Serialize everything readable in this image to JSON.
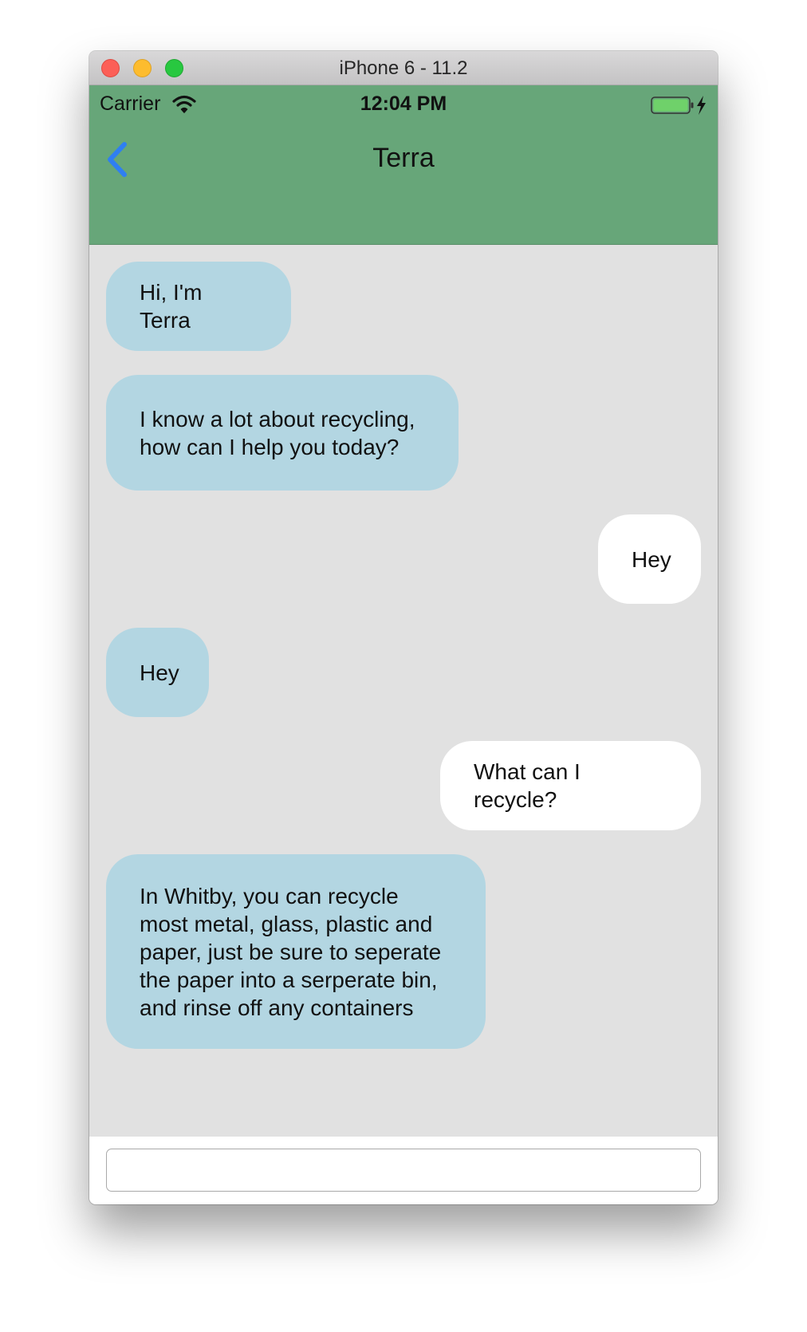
{
  "window": {
    "title": "iPhone 6 - 11.2"
  },
  "status_bar": {
    "carrier": "Carrier",
    "time": "12:04 PM",
    "wifi_icon": "wifi-icon",
    "battery_icon": "battery-charging-icon"
  },
  "nav": {
    "title": "Terra",
    "back_icon": "chevron-left-icon"
  },
  "colors": {
    "header": "#67a679",
    "bot_bubble": "#b3d6e2",
    "user_bubble": "#ffffff",
    "chat_background": "#e1e1e1",
    "back_icon": "#2f7ff1"
  },
  "messages": [
    {
      "sender": "bot",
      "text": "Hi, I'm Terra"
    },
    {
      "sender": "bot",
      "text": "I know a lot about recycling,\nhow can I help you today?"
    },
    {
      "sender": "user",
      "text": "Hey"
    },
    {
      "sender": "bot",
      "text": "Hey"
    },
    {
      "sender": "user",
      "text": "What can I recycle?"
    },
    {
      "sender": "bot",
      "text": "In Whitby, you can recycle\nmost metal, glass, plastic and\npaper, just be sure to seperate\nthe paper into a serperate bin,\nand rinse off any containers"
    }
  ],
  "composer": {
    "value": "",
    "placeholder": ""
  }
}
